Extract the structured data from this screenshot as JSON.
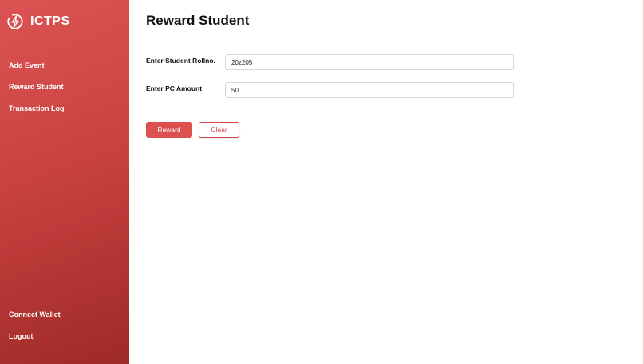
{
  "app": {
    "name": "ICTPS"
  },
  "sidebar": {
    "nav_items": [
      {
        "label": "Add Event"
      },
      {
        "label": "Reward Student"
      },
      {
        "label": "Transaction Log"
      }
    ],
    "bottom_items": [
      {
        "label": "Connect Wallet"
      },
      {
        "label": "Logout"
      }
    ]
  },
  "main": {
    "title": "Reward Student",
    "form": {
      "rollno": {
        "label": "Enter Student Rollno.",
        "value": "20z205"
      },
      "amount": {
        "label": "Enter PC Amount",
        "value": "50"
      }
    },
    "buttons": {
      "reward": "Reward",
      "clear": "Clear"
    }
  },
  "colors": {
    "accent": "#dd5050",
    "sidebar_gradient_start": "#dd5353",
    "sidebar_gradient_end": "#9f2a26",
    "text": "#111111"
  },
  "icons": {
    "brand_logo": "power-bolt-icon"
  }
}
